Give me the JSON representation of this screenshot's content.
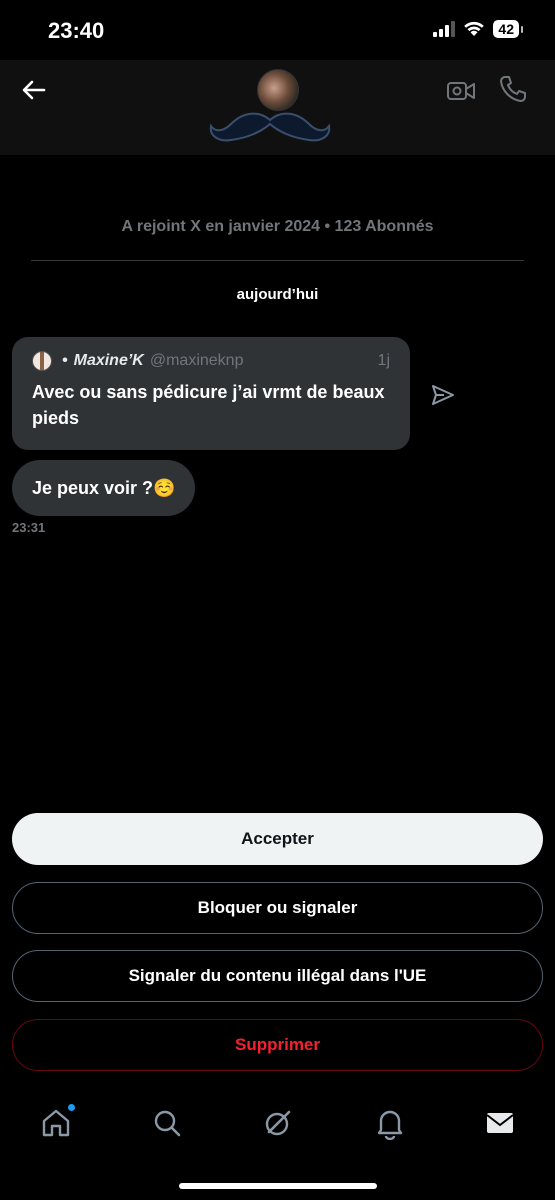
{
  "status_bar": {
    "time": "23:40",
    "battery": "42"
  },
  "header": {
    "back_icon": "arrow-left-icon",
    "video_icon": "video-camera-icon",
    "call_icon": "phone-icon"
  },
  "conversation": {
    "joined_info": "A rejoint X en janvier 2024 • 123 Abonnés",
    "date_label": "aujourd’hui",
    "quoted_post": {
      "separator": "•",
      "author_name": "Maxine’K",
      "author_handle": "@maxineknp",
      "time_ago": "1j",
      "text": "Avec ou sans pédicure j’ai vrmt de beaux pieds"
    },
    "message": {
      "text": "Je peux voir ?☺️",
      "time": "23:31"
    }
  },
  "actions": {
    "accept": "Accepter",
    "block_report": "Bloquer ou signaler",
    "report_illegal_eu": "Signaler du contenu illégal dans l'UE",
    "delete": "Supprimer"
  },
  "tab_bar": {
    "icons": [
      "home-icon",
      "search-icon",
      "grok-icon",
      "notifications-icon",
      "messages-icon"
    ]
  },
  "colors": {
    "background": "#000000",
    "bubble": "#2f3336",
    "accent_blue": "#1d9bf0",
    "danger_red": "#f4212e",
    "muted": "#71767b"
  }
}
